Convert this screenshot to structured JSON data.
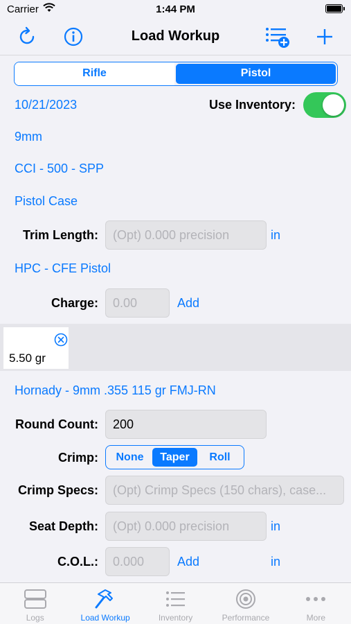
{
  "status": {
    "carrier": "Carrier",
    "time": "1:44 PM"
  },
  "nav": {
    "title": "Load Workup",
    "left_icons": [
      "refresh-icon",
      "info-icon"
    ],
    "right_icons": [
      "add-list-icon",
      "plus-icon"
    ]
  },
  "segment": {
    "options": [
      "Rifle",
      "Pistol"
    ],
    "selected": "Pistol"
  },
  "form": {
    "date": "10/21/2023",
    "use_inventory_label": "Use Inventory:",
    "use_inventory": true,
    "caliber": "9mm",
    "primer": "CCI - 500 - SPP",
    "case": "Pistol Case",
    "trim_label": "Trim Length:",
    "trim_placeholder": "(Opt) 0.000 precision",
    "trim_unit": "in",
    "powder": "HPC - CFE Pistol",
    "charge_label": "Charge:",
    "charge_placeholder": "0.00",
    "charge_add": "Add",
    "charges": [
      "5.50 gr"
    ],
    "bullet": "Hornady - 9mm .355 115 gr FMJ-RN",
    "round_count_label": "Round Count:",
    "round_count": "200",
    "crimp_label": "Crimp:",
    "crimp_options": [
      "None",
      "Taper",
      "Roll"
    ],
    "crimp_selected": "Taper",
    "crimp_specs_label": "Crimp Specs:",
    "crimp_specs_placeholder": "(Opt) Crimp Specs (150 chars), case...",
    "seat_depth_label": "Seat Depth:",
    "seat_depth_placeholder": "(Opt) 0.000 precision",
    "seat_depth_unit": "in",
    "col_label": "C.O.L.:",
    "col_placeholder": "0.000",
    "col_add": "Add",
    "col_unit": "in"
  },
  "tabs": [
    {
      "label": "Logs",
      "icon": "logs-icon"
    },
    {
      "label": "Load Workup",
      "icon": "hammer-icon",
      "active": true
    },
    {
      "label": "Inventory",
      "icon": "list-icon"
    },
    {
      "label": "Performance",
      "icon": "target-icon"
    },
    {
      "label": "More",
      "icon": "more-icon"
    }
  ],
  "colors": {
    "accent": "#0a7aff",
    "toggle_on": "#34c759"
  }
}
